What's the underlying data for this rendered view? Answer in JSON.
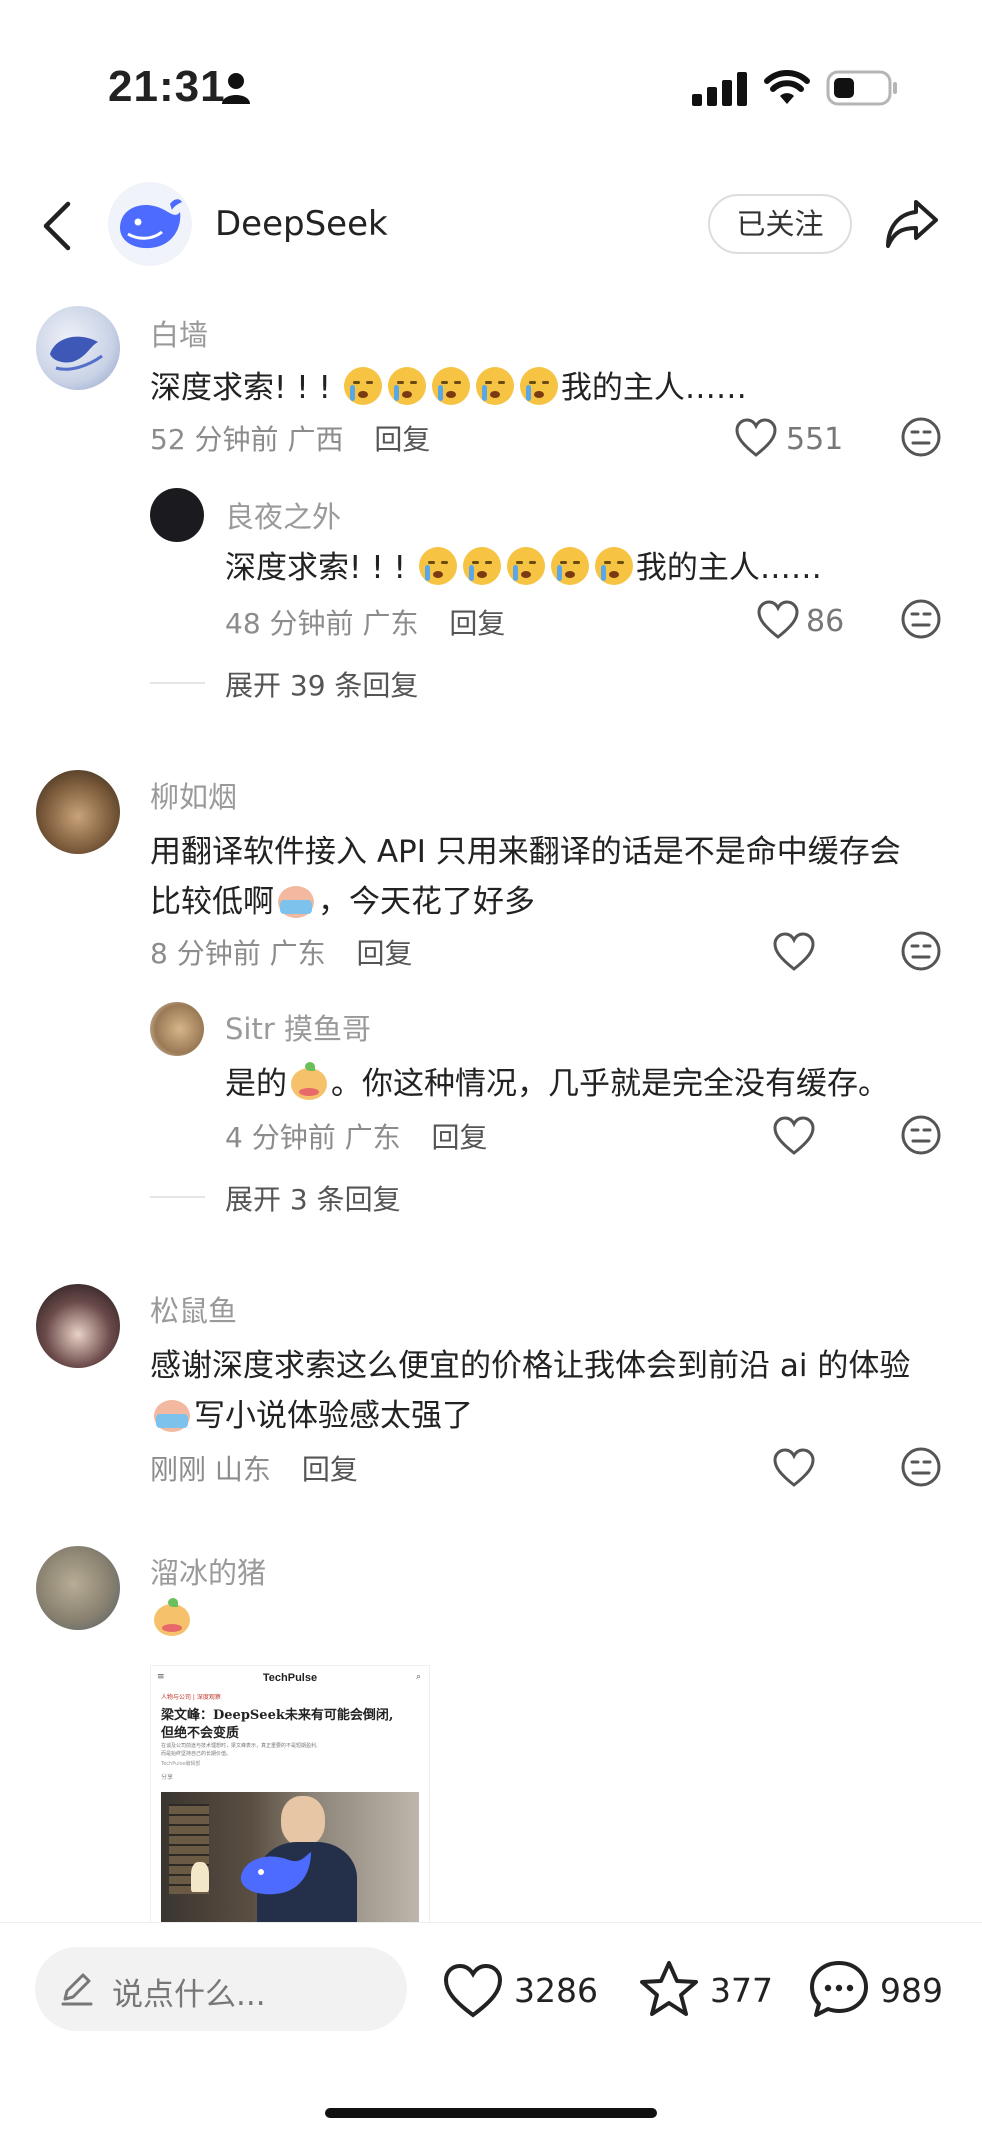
{
  "status_bar": {
    "time": "21:31"
  },
  "header": {
    "title": "DeepSeek",
    "follow_label": "已关注"
  },
  "comments": [
    {
      "name": "白墙",
      "text_prefix": "深度求索! ! !",
      "text_suffix": "我的主人……",
      "emoji_count": 5,
      "time": "52 分钟前",
      "location": "广西",
      "reply_label": "回复",
      "likes": "551",
      "sub": {
        "name": "良夜之外",
        "text_prefix": "深度求索! ! !",
        "text_suffix": "我的主人……",
        "time": "48 分钟前",
        "location": "广东",
        "reply_label": "回复",
        "likes": "86"
      },
      "expand": "展开 39 条回复"
    },
    {
      "name": "柳如烟",
      "line1": "用翻译软件接入 API 只用来翻译的话是不是命中缓存会",
      "line2_prefix": "比较低啊",
      "line2_suffix": "，今天花了好多",
      "time": "8 分钟前",
      "location": "广东",
      "reply_label": "回复",
      "sub": {
        "name": "Sitr 摸鱼哥",
        "text_prefix": "是的",
        "text_suffix": "。你这种情况，几乎就是完全没有缓存。",
        "time": "4 分钟前",
        "location": "广东",
        "reply_label": "回复"
      },
      "expand": "展开 3 条回复"
    },
    {
      "name": "松鼠鱼",
      "line1": "感谢深度求索这么便宜的价格让我体会到前沿 ai 的体验",
      "line2_suffix": "写小说体验感太强了",
      "time": "刚刚",
      "location": "山东",
      "reply_label": "回复"
    },
    {
      "name": "溜冰的猪",
      "card": {
        "site": "TechPulse",
        "tag": "人物与公司 | 深度观察",
        "headline1": "梁文峰：DeepSeek未来有可能会倒闭,",
        "headline2": "但绝不会变质",
        "desc1": "在谈及公司前途与技术理想时，梁文峰表示，真正重要的不是短期盈利,",
        "desc2": "而是始终坚持自己的长期价值。",
        "byline": "TechPulse编辑部",
        "share": "分享"
      }
    }
  ],
  "bottom_bar": {
    "input_placeholder": "说点什么...",
    "likes": "3286",
    "stars": "377",
    "comments": "989"
  },
  "colors": {
    "accent_blue": "#4d6bfe",
    "text_gray": "#8c8c8c"
  }
}
